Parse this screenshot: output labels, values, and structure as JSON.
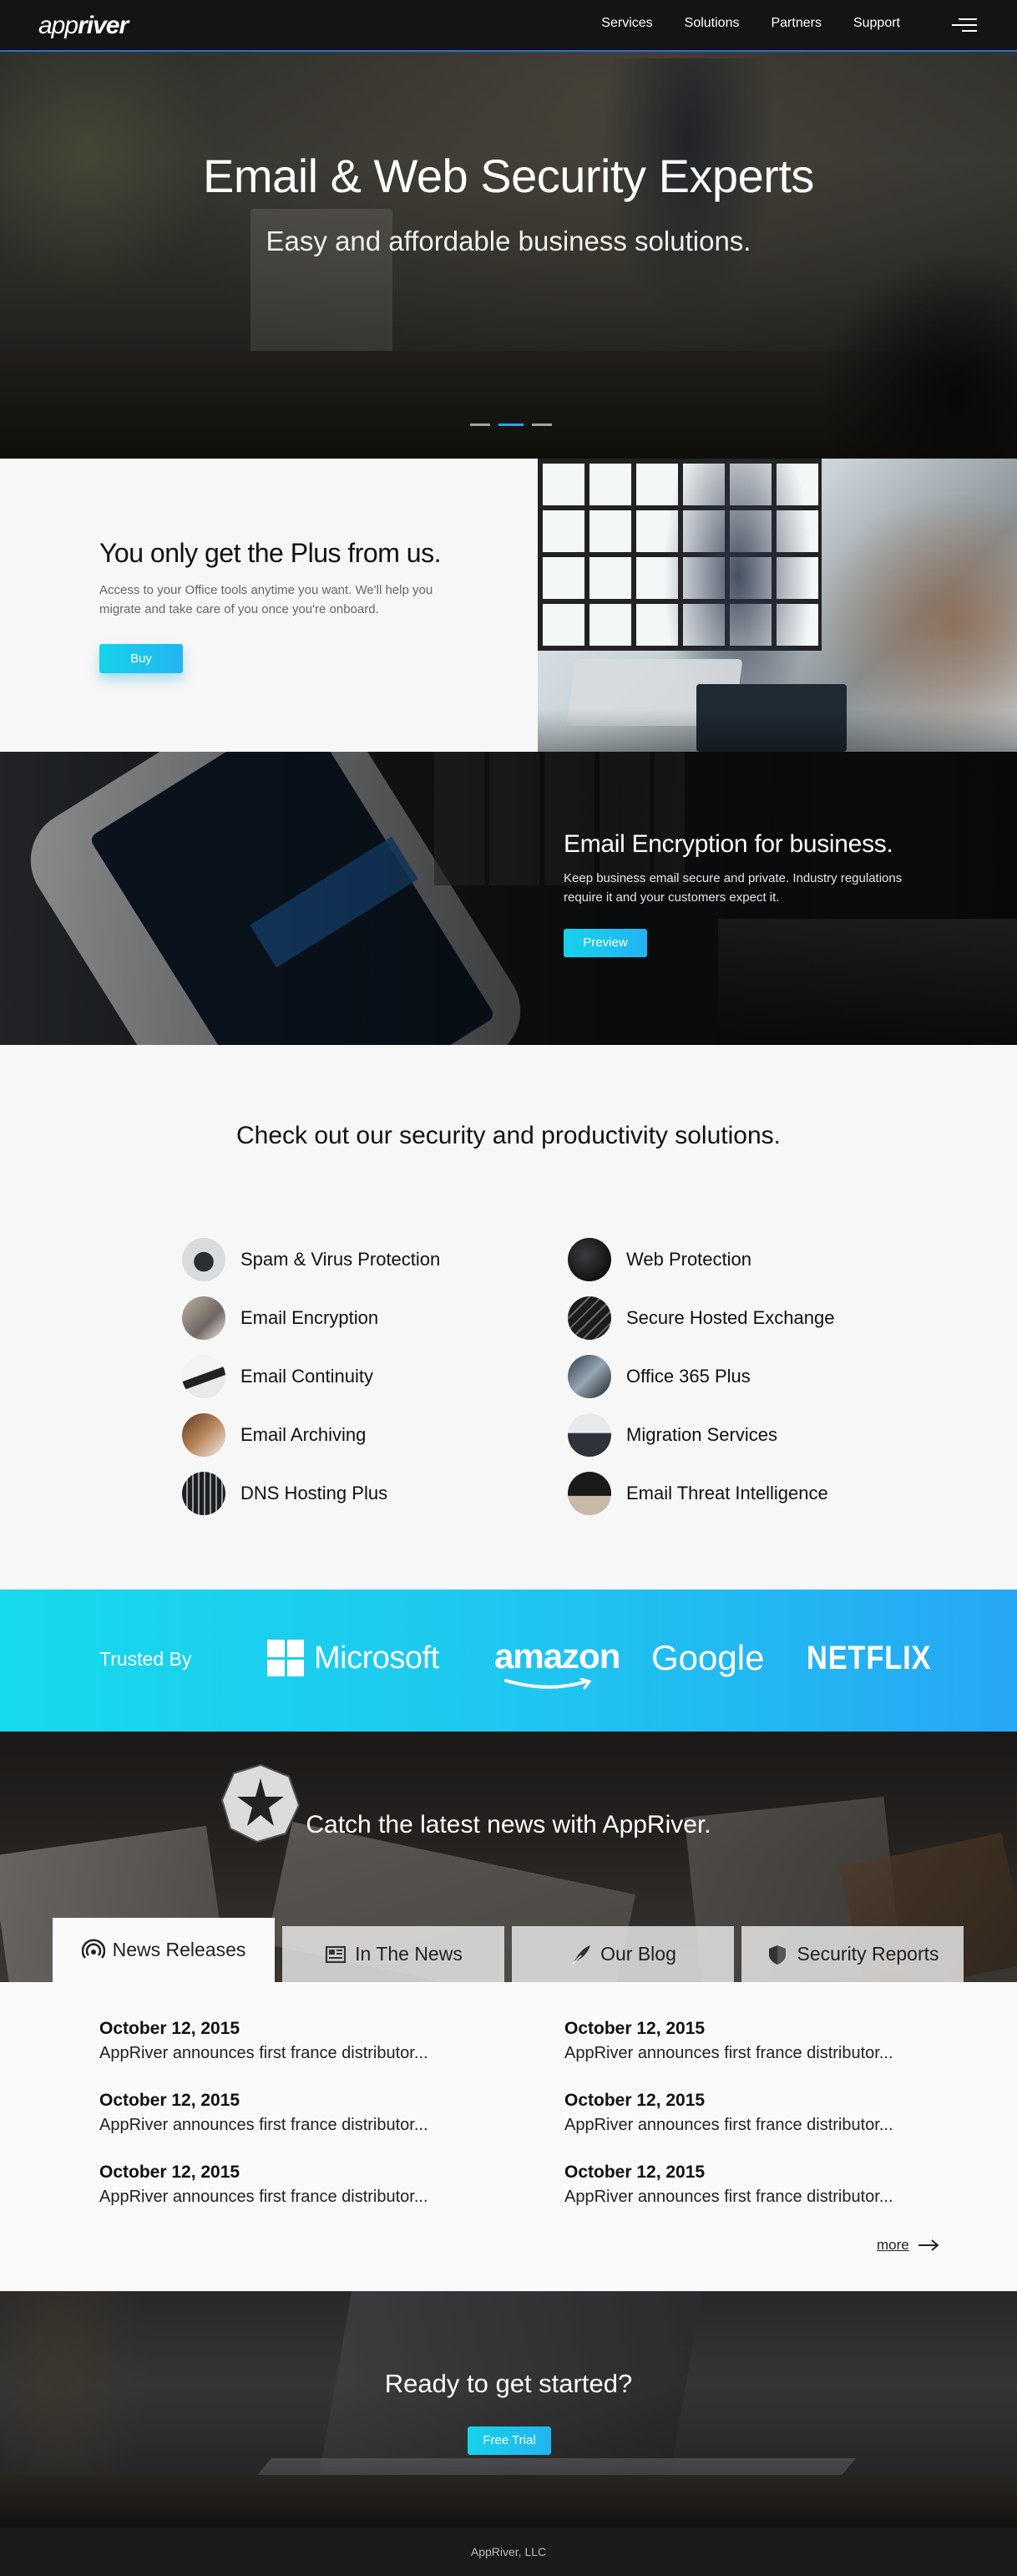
{
  "nav": {
    "logo_light": "app",
    "logo_bold": "river",
    "links": [
      "Services",
      "Solutions",
      "Partners",
      "Support"
    ]
  },
  "hero": {
    "title": "Email & Web Security Experts",
    "subtitle": "Easy and affordable business solutions.",
    "slides": 3,
    "active_slide": 2
  },
  "plus": {
    "heading": "You only get the Plus from us.",
    "body": "Access to your Office tools anytime you want. We'll help you migrate and take care of you once you're onboard.",
    "button": "Buy"
  },
  "encryption": {
    "heading": "Email Encryption for business.",
    "body": "Keep business email secure and private. Industry regulations require it and your customers expect it.",
    "button": "Preview"
  },
  "solutions": {
    "heading": "Check out our security and productivity solutions.",
    "left": [
      "Spam & Virus Protection",
      "Email Encryption",
      "Email Continuity",
      "Email Archiving",
      "DNS Hosting Plus"
    ],
    "right": [
      "Web Protection",
      "Secure Hosted Exchange",
      "Office 365 Plus",
      "Migration Services",
      "Email Threat Intelligence"
    ]
  },
  "trusted": {
    "label": "Trusted By",
    "brands": [
      "Microsoft",
      "amazon",
      "Google",
      "NETFLIX"
    ]
  },
  "news": {
    "heading": "Catch the latest news with AppRiver.",
    "tabs": [
      "News Releases",
      "In The News",
      "Our Blog",
      "Security Reports"
    ],
    "active_tab": "News Releases",
    "items_left": [
      {
        "date": "October 12, 2015",
        "headline": "AppRiver announces first france distributor..."
      },
      {
        "date": "October 12, 2015",
        "headline": "AppRiver announces first france distributor..."
      },
      {
        "date": "October 12, 2015",
        "headline": "AppRiver announces first france distributor..."
      }
    ],
    "items_right": [
      {
        "date": "October 12, 2015",
        "headline": "AppRiver announces first france distributor..."
      },
      {
        "date": "October 12, 2015",
        "headline": "AppRiver announces first france distributor..."
      },
      {
        "date": "October 12, 2015",
        "headline": "AppRiver announces first france distributor..."
      }
    ],
    "more": "more"
  },
  "cta": {
    "heading": "Ready to get started?",
    "button": "Free Trial"
  },
  "footer": {
    "text": "AppRiver, LLC"
  },
  "colors": {
    "accent_cyan": "#16d2ea",
    "accent_blue": "#27a7f4",
    "nav_bg": "#121416",
    "nav_border": "#2a6fd6"
  }
}
